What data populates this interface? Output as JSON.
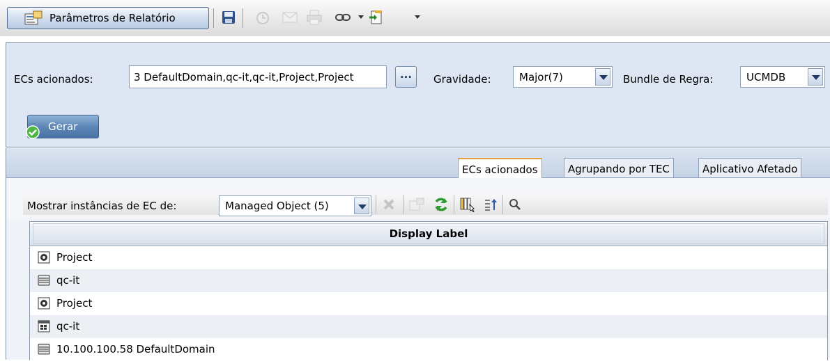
{
  "toolbar": {
    "report_params_label": "Parâmetros de Relatório",
    "icons": [
      "report-params-icon",
      "save-icon",
      "schedule-icon",
      "email-icon",
      "print-icon",
      "link-icon",
      "export-icon"
    ]
  },
  "params": {
    "ecs_label": "ECs acionados:",
    "ecs_value": "3 DefaultDomain,qc-it,qc-it,Project,Project",
    "dots_label": "...",
    "severity_label": "Gravidade:",
    "severity_value": "Major(7)",
    "bundle_label": "Bundle de Regra:",
    "bundle_value": "UCMDB",
    "generate_label": "Gerar"
  },
  "tabs": [
    {
      "label": "ECs acionados",
      "active": true
    },
    {
      "label": "Agrupando por TEC",
      "active": false
    },
    {
      "label": "Aplicativo Afetado",
      "active": false
    }
  ],
  "subbar": {
    "show_label": "Mostrar instâncias de EC de:",
    "show_value": "Managed Object (5)"
  },
  "table": {
    "header": "Display Label",
    "rows": [
      {
        "icon": "project-icon",
        "label": "Project"
      },
      {
        "icon": "server-icon",
        "label": "qc-it"
      },
      {
        "icon": "project-icon",
        "label": "Project"
      },
      {
        "icon": "windows-node-icon",
        "label": "qc-it"
      },
      {
        "icon": "server-icon",
        "label": "10.100.100.58 DefaultDomain"
      }
    ]
  },
  "colors": {
    "accent": "#5e86b6",
    "panel_bg": "#dde6f2",
    "tab_active_border": "#e9a23b",
    "refresh_green": "#2f9a2f"
  }
}
